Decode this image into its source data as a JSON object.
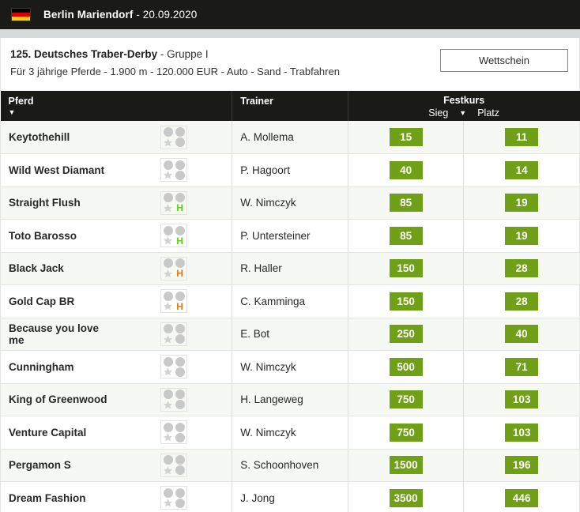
{
  "topbar": {
    "flag_icon": "german-flag-icon",
    "venue": "Berlin Mariendorf",
    "separator": " - ",
    "date": "20.09.2020"
  },
  "race": {
    "title_main": "125. Deutsches Traber-Derby",
    "title_group": " - Gruppe I",
    "subtitle": "Für 3 jährige Pferde - 1.900 m - 120.000 EUR - Auto - Sand - Trabfahren",
    "betslip_button": "Wettschein"
  },
  "table": {
    "headers": {
      "horse": "Pferd",
      "horse_sort_caret": "▼",
      "trainer": "Trainer",
      "odds_group": "Festkurs",
      "win": "Sieg",
      "win_sort_caret": "▼",
      "place": "Platz"
    },
    "rows": [
      {
        "horse": "Keytothehill",
        "trainer": "A. Mollema",
        "win": "15",
        "place": "11",
        "hmark": "",
        "hmark_color": ""
      },
      {
        "horse": "Wild West Diamant",
        "trainer": "P. Hagoort",
        "win": "40",
        "place": "14",
        "hmark": "",
        "hmark_color": ""
      },
      {
        "horse": "Straight Flush",
        "trainer": "W. Nimczyk",
        "win": "85",
        "place": "19",
        "hmark": "H",
        "hmark_color": "green"
      },
      {
        "horse": "Toto Barosso",
        "trainer": "P. Untersteiner",
        "win": "85",
        "place": "19",
        "hmark": "H",
        "hmark_color": "green"
      },
      {
        "horse": "Black Jack",
        "trainer": "R. Haller",
        "win": "150",
        "place": "28",
        "hmark": "H",
        "hmark_color": "orange"
      },
      {
        "horse": "Gold Cap BR",
        "trainer": "C. Kamminga",
        "win": "150",
        "place": "28",
        "hmark": "H",
        "hmark_color": "orange"
      },
      {
        "horse": "Because you love me",
        "trainer": "E. Bot",
        "win": "250",
        "place": "40",
        "hmark": "",
        "hmark_color": ""
      },
      {
        "horse": "Cunningham",
        "trainer": "W. Nimczyk",
        "win": "500",
        "place": "71",
        "hmark": "",
        "hmark_color": ""
      },
      {
        "horse": "King of Greenwood",
        "trainer": "H. Langeweg",
        "win": "750",
        "place": "103",
        "hmark": "",
        "hmark_color": ""
      },
      {
        "horse": "Venture Capital",
        "trainer": "W. Nimczyk",
        "win": "750",
        "place": "103",
        "hmark": "",
        "hmark_color": ""
      },
      {
        "horse": "Pergamon S",
        "trainer": "S. Schoonhoven",
        "win": "1500",
        "place": "196",
        "hmark": "",
        "hmark_color": ""
      },
      {
        "horse": "Dream Fashion",
        "trainer": "J. Jong",
        "win": "3500",
        "place": "446",
        "hmark": "",
        "hmark_color": ""
      }
    ]
  },
  "colors": {
    "header_bg": "#1a1a17",
    "odds_badge": "#6fa017",
    "row_alt": "#f6f8f3",
    "hmark_green": "#5dd21a",
    "hmark_orange": "#ec7a08"
  }
}
